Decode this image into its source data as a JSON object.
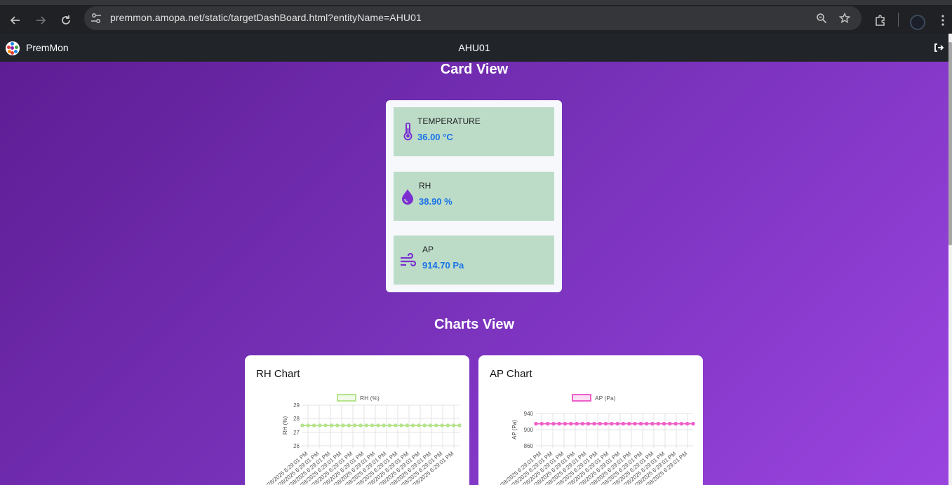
{
  "browser": {
    "url": "premmon.amopa.net/static/targetDashBoard.html?entityName=AHU01"
  },
  "app": {
    "brand": "PremMon",
    "entity_name": "AHU01"
  },
  "card_view": {
    "title": "Card View",
    "cards": [
      {
        "icon": "thermometer-icon",
        "label": "TEMPERATURE",
        "value": "36.00 °C"
      },
      {
        "icon": "water-drop-icon",
        "label": "RH",
        "value": "38.90 %"
      },
      {
        "icon": "wind-icon",
        "label": "AP",
        "value": "914.70 Pa"
      }
    ]
  },
  "charts_view": {
    "title": "Charts View"
  },
  "colors": {
    "rh_line": "#b5e48c",
    "ap_line": "#ee5fc9",
    "card_bg": "#bcdcc8",
    "value_text": "#1a73e8"
  },
  "chart_data": [
    {
      "type": "line",
      "title": "RH Chart",
      "ylabel": "RH (%)",
      "ylim": [
        26,
        29
      ],
      "yticks": [
        "29",
        "28",
        "27",
        "26"
      ],
      "x": [
        "/28/2025 6:29:01 PM",
        "6/28/2025 6:29:01 PM",
        "6/28/2025 6:29:01 PM",
        "6/28/2025 6:29:01 PM",
        "6/28/2025 6:29:01 PM",
        "6/28/2025 6:29:01 PM",
        "6/28/2025 6:29:01 PM",
        "6/28/2025 6:29:01 PM",
        "6/28/2025 6:29:01 PM",
        "6/28/2025 6:29:01 PM",
        "6/28/2025 6:29:01 PM",
        "6/28/2025 6:29:01 PM",
        "6/28/2025 6:29:01 PM",
        "6/28/2025 6:29:01 PM"
      ],
      "series": [
        {
          "name": "RH (%)",
          "color": "#b5e48c",
          "values": [
            27.5,
            27.5,
            27.5,
            27.5,
            27.5,
            27.5,
            27.5,
            27.5,
            27.5,
            27.5,
            27.5,
            27.5,
            27.5,
            27.5,
            27.5,
            27.5,
            27.5,
            27.5,
            27.5,
            27.5,
            27.5,
            27.5,
            27.5,
            27.5,
            27.5,
            27.5,
            27.5,
            27.5
          ]
        }
      ],
      "grid": true,
      "legend": "top"
    },
    {
      "type": "line",
      "title": "AP Chart",
      "ylabel": "AP (Pa)",
      "ylim": [
        850,
        950
      ],
      "yticks": [
        "940",
        "900",
        "860"
      ],
      "x": [
        "/28/2025 6:29:01 PM",
        "6/28/2025 6:29:01 PM",
        "6/28/2025 6:29:01 PM",
        "6/28/2025 6:29:01 PM",
        "6/28/2025 6:29:01 PM",
        "6/28/2025 6:29:01 PM",
        "6/28/2025 6:29:01 PM",
        "6/28/2025 6:29:01 PM",
        "6/28/2025 6:29:01 PM",
        "6/28/2025 6:29:01 PM",
        "6/28/2025 6:29:01 PM",
        "6/28/2025 6:29:01 PM",
        "6/28/2025 6:29:01 PM",
        "6/28/2025 6:29:01 PM"
      ],
      "series": [
        {
          "name": "AP (Pa)",
          "color": "#ee5fc9",
          "values": [
            914.7,
            914.7,
            914.7,
            914.7,
            914.7,
            914.7,
            914.7,
            914.7,
            914.7,
            914.7,
            914.7,
            914.7,
            914.7,
            914.7,
            914.7,
            914.7,
            914.7,
            914.7,
            914.7,
            914.7,
            914.7,
            914.7,
            914.7,
            914.7,
            914.7,
            914.7,
            914.7,
            914.7
          ]
        }
      ],
      "grid": true,
      "legend": "top"
    }
  ]
}
